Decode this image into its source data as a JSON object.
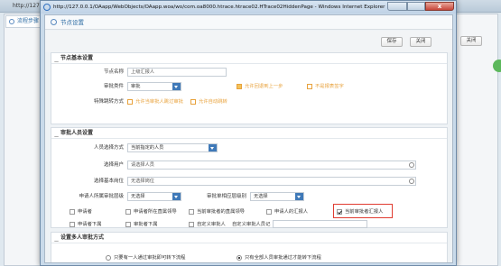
{
  "background": {
    "title": "http://127.0.0.1/",
    "tab_label": "流程步骤",
    "close_label": "关闭"
  },
  "window": {
    "title": "http://127.0.0.1/OAapp/WebObjects/OAapp.woa/wo/com.oa8000.htrace.htrace02.HTrace02HiddenPage - Windows Internet Explorer",
    "close_symbol": "x"
  },
  "page": {
    "title": "节点设置"
  },
  "toolbar": {
    "save_label": "保存",
    "close_label": "关闭"
  },
  "node_basic": {
    "header": "节点基本设置",
    "collapse": "—",
    "node_name_label": "节点名称",
    "node_name_value": "上级汇报人",
    "approve_type_label": "审批类件",
    "approve_type_value": "审批",
    "allow_back_label": "允许回退到上一步",
    "no_print_label": "不是报表签字",
    "special_label": "特殊跳转方式",
    "special_opt1": "允许当审批人跳过审批",
    "special_opt2": "允许自动跳转"
  },
  "approver": {
    "header": "审批人员设置",
    "collapse": "—",
    "select_mode_label": "人员选择方式",
    "select_mode_value": "当前指定的人员",
    "select_user_label": "选择用户",
    "select_user_placeholder": "请选择人员",
    "select_post_label": "选择基本岗位",
    "select_post_placeholder": "无选择岗位",
    "dept_level_label": "申请人所属审批层级",
    "dept_level_value": "无选择",
    "approver_dept_label": "审批单相应层级别",
    "approver_dept_value": "无选择",
    "checkbox_row1": [
      "申请者",
      "申请者所在直属领导",
      "当前审批者的直属领导",
      "申请人的汇报人",
      "当前审批者汇报人"
    ],
    "checkbox_row2": [
      "申请者下属",
      "审批者下属",
      "自定义审批人"
    ],
    "custom_label": "自定义审批人员记"
  },
  "multi": {
    "header": "设置多人审批方式",
    "collapse": "—",
    "opt1": "只要有一人通过审批即可转下流程",
    "opt2": "只有全部人员审批通过才能转下流程"
  }
}
